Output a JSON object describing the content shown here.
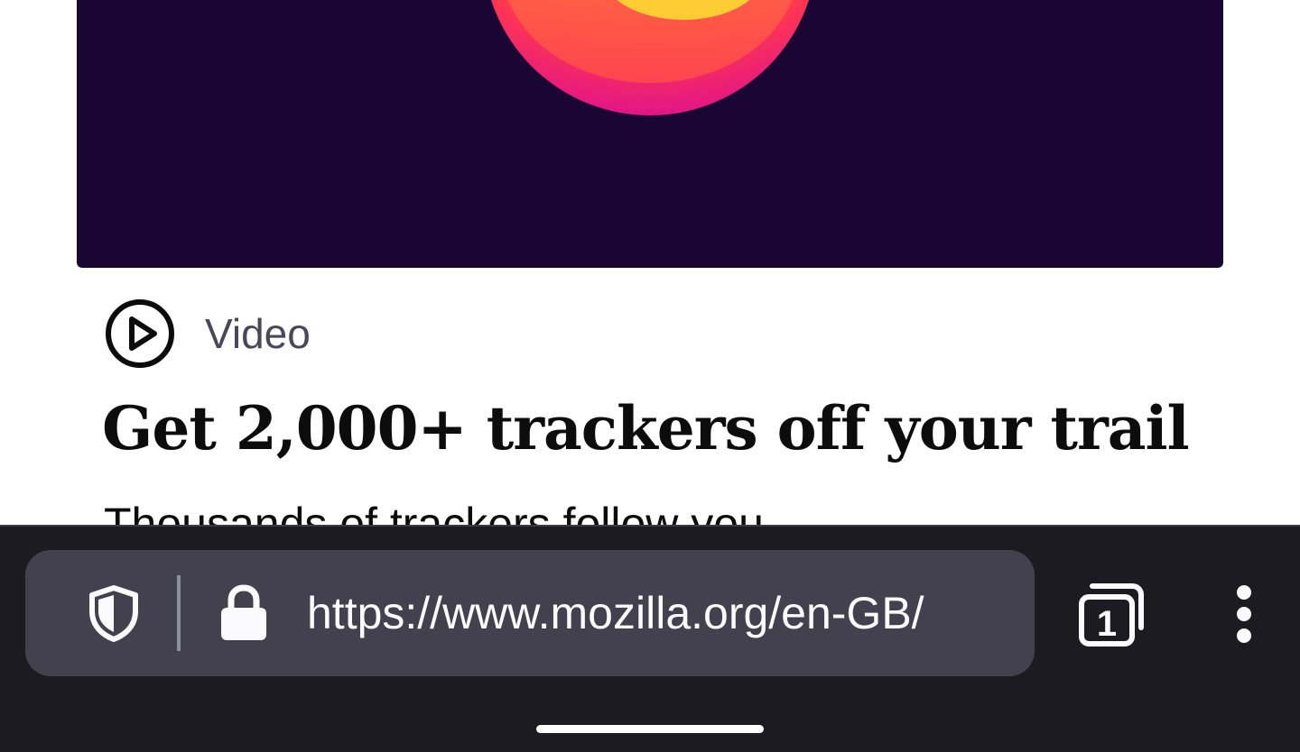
{
  "article": {
    "category": "Video",
    "headline": "Get 2,000+ trackers off your trail",
    "body_excerpt": "Thousands of trackers follow you"
  },
  "toolbar": {
    "url": "https://www.mozilla.org/en-GB/",
    "tab_count": "1",
    "icons": {
      "tracking_protection": "shield-icon",
      "security": "lock-icon",
      "tabs": "tabs-icon",
      "menu": "more-vertical-icon"
    }
  },
  "colors": {
    "hero_background": "#1a0633",
    "toolbar_background": "#1c1b22",
    "urlbar_background": "#42414d"
  }
}
